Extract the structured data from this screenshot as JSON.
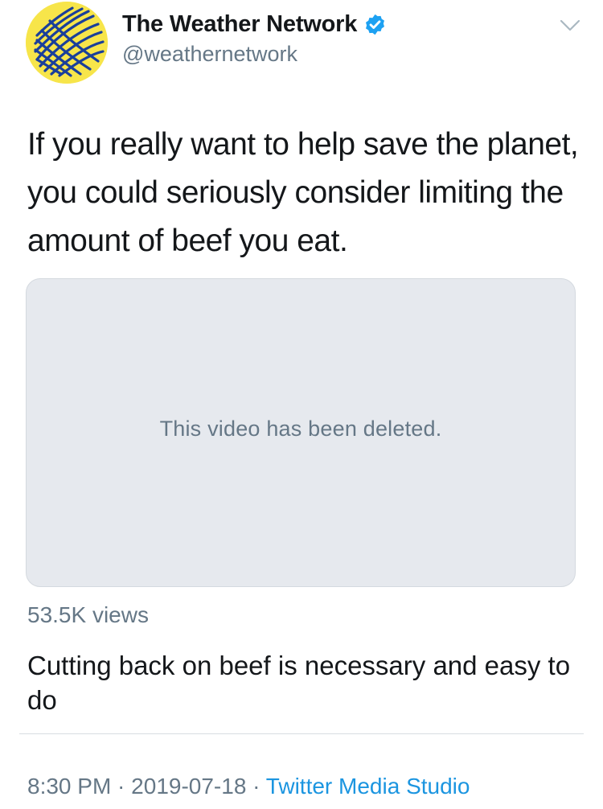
{
  "tweet": {
    "author": {
      "display_name": "The Weather Network",
      "handle": "@weathernetwork",
      "verified": true,
      "avatar_icon": "weather-network-globe-logo",
      "avatar_color": "#f7e54a"
    },
    "text": "If you really want to help save the planet, you could seriously consider limiting the amount of beef you eat.",
    "media": {
      "message": "This video has been deleted."
    },
    "views": "53.5K views",
    "video_title": "Cutting back on beef is necessary and easy to do",
    "timestamp": {
      "time": "8:30 PM",
      "separator_1": " · ",
      "date": "2019-07-18",
      "separator_2": " · ",
      "source": "Twitter Media Studio"
    }
  },
  "colors": {
    "text": "#14171a",
    "secondary": "#657786",
    "link": "#1b95e0",
    "verified": "#1da1f2",
    "logo_blue": "#1a3f9a"
  }
}
